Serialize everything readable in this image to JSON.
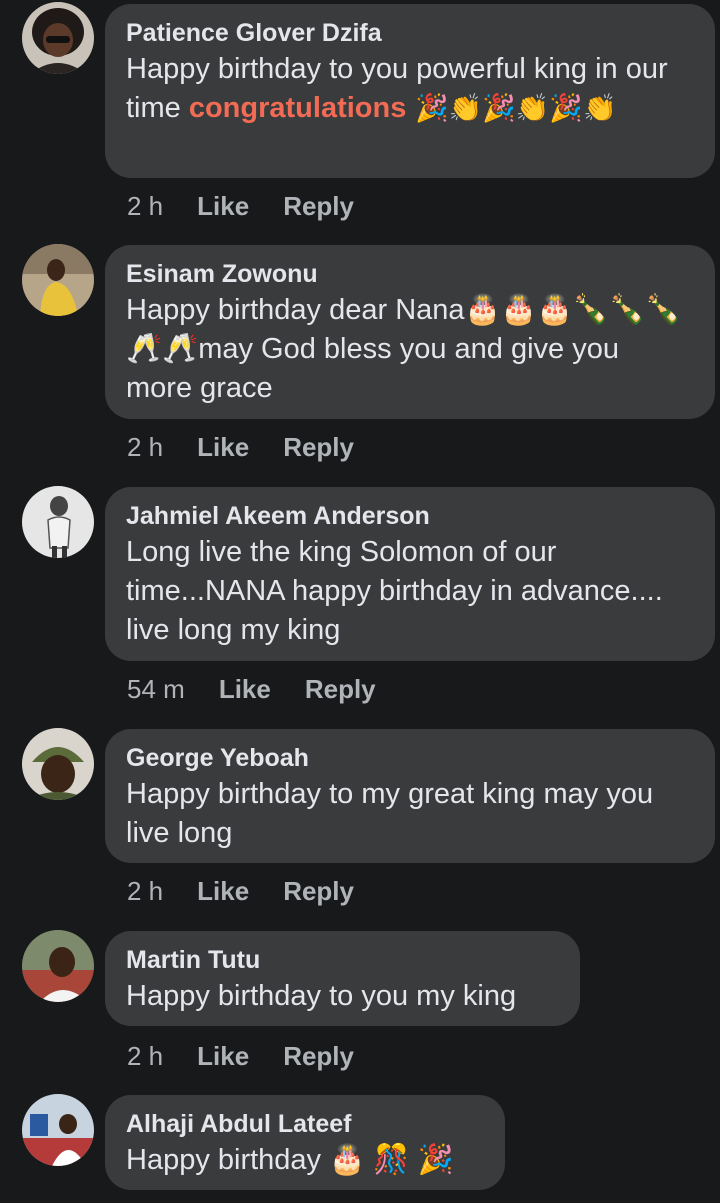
{
  "comments": [
    {
      "author": "Patience Glover Dzifa",
      "text_before": "Happy birthday to you powerful king in our time ",
      "highlight": "congratulations",
      "text_after": " 🎉👏🎉👏🎉👏",
      "time": "2 h",
      "like": "Like",
      "reply": "Reply"
    },
    {
      "author": "Esinam Zowonu",
      "text": "Happy birthday dear Nana🎂🎂🎂🍾🍾🍾🥂🥂may God bless you and give you more grace",
      "time": "2 h",
      "like": "Like",
      "reply": "Reply"
    },
    {
      "author": "Jahmiel Akeem Anderson",
      "text": "Long live the king Solomon of our time...NANA happy birthday in advance.... live long my king",
      "time": "54 m",
      "like": "Like",
      "reply": "Reply"
    },
    {
      "author": "George Yeboah",
      "text": "Happy birthday to my great king may you live long",
      "time": "2 h",
      "like": "Like",
      "reply": "Reply"
    },
    {
      "author": "Martin Tutu",
      "text": "Happy birthday to you my  king",
      "time": "2 h",
      "like": "Like",
      "reply": "Reply"
    },
    {
      "author": "Alhaji Abdul Lateef",
      "text": "Happy birthday 🎂 🎊 🎉"
    }
  ],
  "colors": {
    "background": "#18191a",
    "bubble": "#3a3b3c",
    "text": "#e4e6eb",
    "meta": "#b0b3b8",
    "highlight": "#f26b54"
  }
}
